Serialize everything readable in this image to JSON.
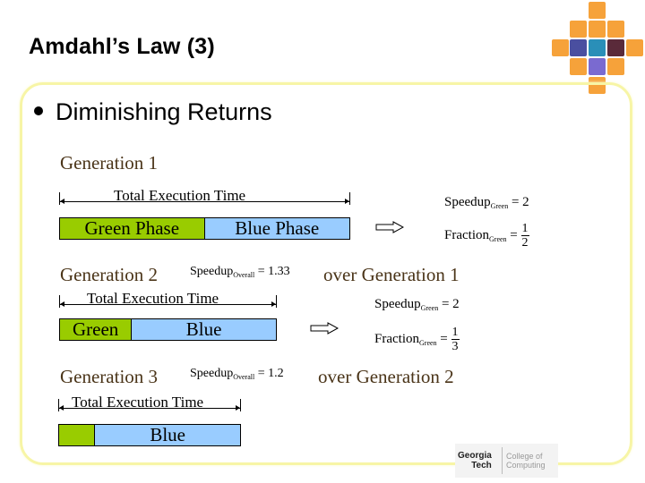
{
  "slide": {
    "title": "Amdahl’s Law (3)",
    "bullet": "Diminishing Returns"
  },
  "colors": {
    "green_phase": "#99cc00",
    "blue_phase": "#99ccff",
    "frame_border": "#f7f5a6",
    "generation_text": "#4a3418",
    "logo_tile": "#f6a23a"
  },
  "generations": [
    {
      "label": "Generation 1",
      "total_label": "Total Execution Time",
      "green_label": "Green Phase",
      "blue_label": "Blue Phase",
      "green_fraction": 0.5,
      "blue_fraction": 0.5,
      "speedup_green": {
        "name": "Speedup",
        "sub": "Green",
        "eq": "= 2"
      },
      "fraction_green": {
        "name": "Fraction",
        "sub": "Green",
        "num": "1",
        "den": "2"
      }
    },
    {
      "label": "Generation 2",
      "overall": {
        "name": "Speedup",
        "sub": "Overall",
        "eq": "= 1.33"
      },
      "over_text": "over Generation 1",
      "total_label": "Total Execution Time",
      "green_label": "Green",
      "blue_label": "Blue",
      "green_fraction": 0.333,
      "blue_fraction": 0.667,
      "speedup_green": {
        "name": "Speedup",
        "sub": "Green",
        "eq": "= 2"
      },
      "fraction_green": {
        "name": "Fraction",
        "sub": "Green",
        "num": "1",
        "den": "3"
      }
    },
    {
      "label": "Generation 3",
      "overall": {
        "name": "Speedup",
        "sub": "Overall",
        "eq": "= 1.2"
      },
      "over_text": "over Generation 2",
      "total_label": "Total Execution Time",
      "green_label": "",
      "blue_label": "Blue",
      "green_fraction": 0.2,
      "blue_fraction": 0.8
    }
  ],
  "logo": {
    "line1": "Georgia",
    "line2": "Tech",
    "line3": "College of",
    "line4": "Computing"
  }
}
